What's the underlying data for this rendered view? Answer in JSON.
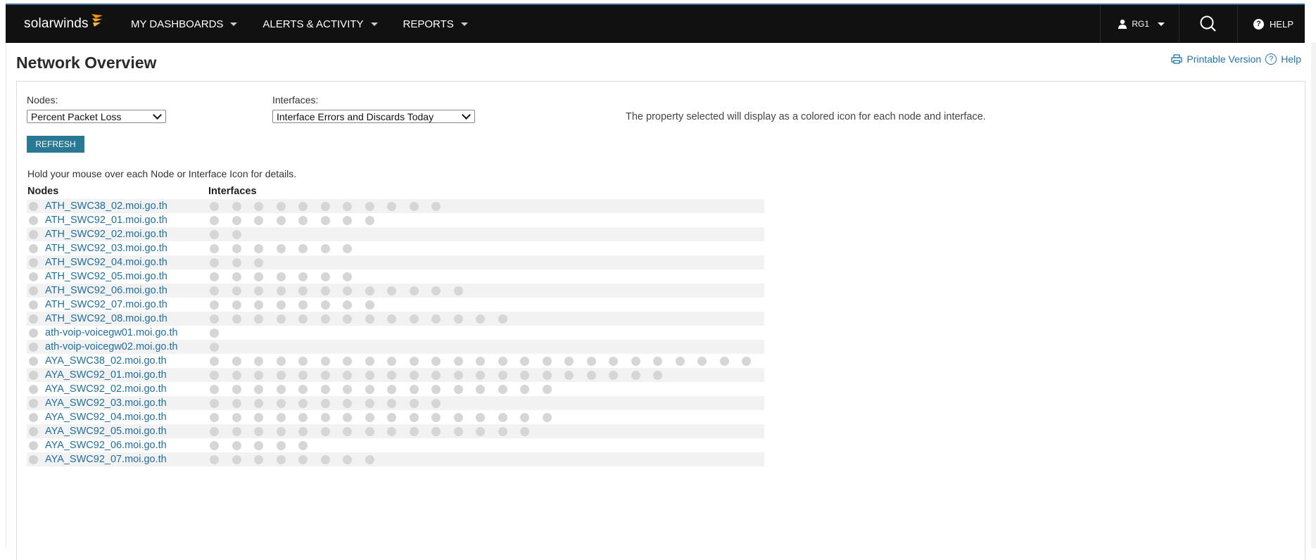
{
  "topbar": {
    "logo_text": "solarwinds",
    "nav": [
      "MY DASHBOARDS",
      "ALERTS & ACTIVITY",
      "REPORTS"
    ],
    "user_label": "RG1",
    "help_label": "HELP",
    "brand_color": "#f29111"
  },
  "page": {
    "title": "Network Overview",
    "printable_label": "Printable Version",
    "help_label": "Help"
  },
  "controls": {
    "nodes_label": "Nodes:",
    "nodes_selected": "Percent Packet Loss",
    "interfaces_label": "Interfaces:",
    "interfaces_selected": "Interface Errors and Discards Today",
    "hint": "The property selected will display as a colored icon for each node and interface.",
    "refresh_label": "REFRESH",
    "instructions": "Hold your mouse over each Node or Interface Icon for details."
  },
  "table": {
    "nodes_header": "Nodes",
    "interfaces_header": "Interfaces",
    "rows": [
      {
        "name": "ATH_SWC38_02.moi.go.th",
        "interfaces": 11
      },
      {
        "name": "ATH_SWC92_01.moi.go.th",
        "interfaces": 8
      },
      {
        "name": "ATH_SWC92_02.moi.go.th",
        "interfaces": 2
      },
      {
        "name": "ATH_SWC92_03.moi.go.th",
        "interfaces": 7
      },
      {
        "name": "ATH_SWC92_04.moi.go.th",
        "interfaces": 3
      },
      {
        "name": "ATH_SWC92_05.moi.go.th",
        "interfaces": 7
      },
      {
        "name": "ATH_SWC92_06.moi.go.th",
        "interfaces": 12
      },
      {
        "name": "ATH_SWC92_07.moi.go.th",
        "interfaces": 8
      },
      {
        "name": "ATH_SWC92_08.moi.go.th",
        "interfaces": 14
      },
      {
        "name": "ath-voip-voicegw01.moi.go.th",
        "interfaces": 1
      },
      {
        "name": "ath-voip-voicegw02.moi.go.th",
        "interfaces": 1
      },
      {
        "name": "AYA_SWC38_02.moi.go.th",
        "interfaces": 25
      },
      {
        "name": "AYA_SWC92_01.moi.go.th",
        "interfaces": 21
      },
      {
        "name": "AYA_SWC92_02.moi.go.th",
        "interfaces": 16
      },
      {
        "name": "AYA_SWC92_03.moi.go.th",
        "interfaces": 11
      },
      {
        "name": "AYA_SWC92_04.moi.go.th",
        "interfaces": 16
      },
      {
        "name": "AYA_SWC92_05.moi.go.th",
        "interfaces": 15
      },
      {
        "name": "AYA_SWC92_06.moi.go.th",
        "interfaces": 5
      },
      {
        "name": "AYA_SWC92_07.moi.go.th",
        "interfaces": 8
      }
    ]
  },
  "colors": {
    "topbar_bg": "#111111",
    "link": "#1f6fa0",
    "refresh_bg": "#297994",
    "status_unknown": "#d6d6d6"
  }
}
